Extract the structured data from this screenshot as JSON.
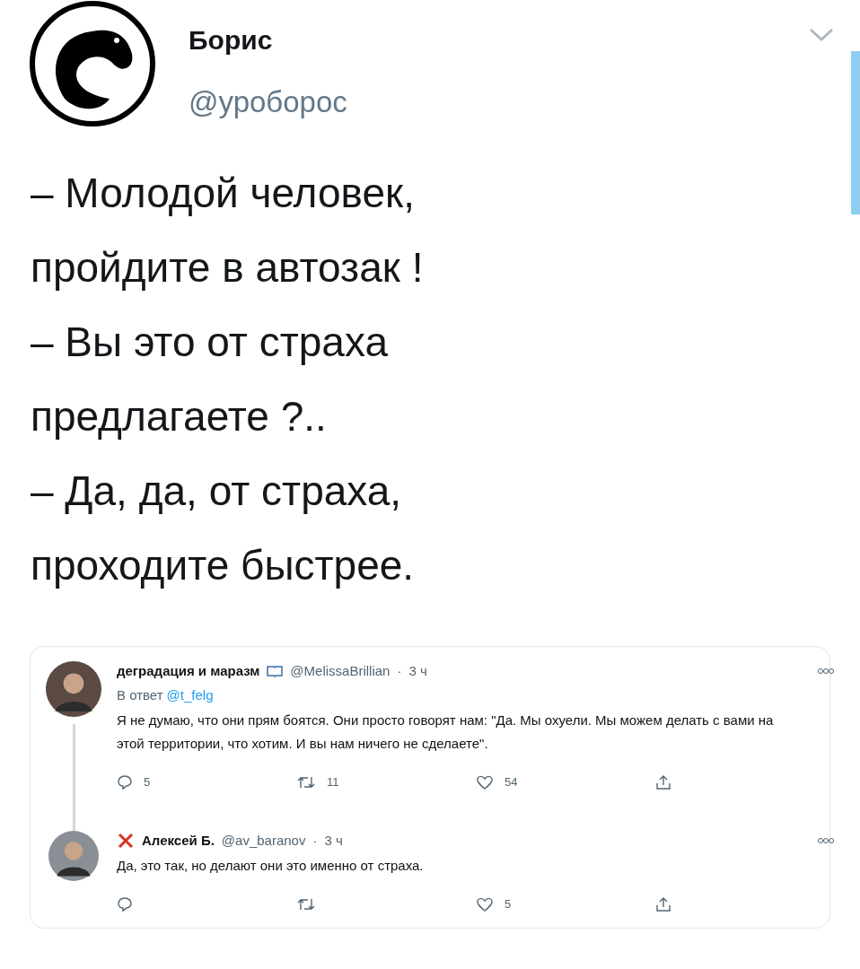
{
  "author": {
    "name": "Борис",
    "handle": "@уроборос"
  },
  "text_lines": [
    "– Молодой человек,",
    "пройдите в автозак !",
    "– Вы это от страха",
    "предлагаете ?..",
    "– Да, да, от страха,",
    "проходите быстрее."
  ],
  "replies": [
    {
      "name": "деградация и маразм",
      "badge": {
        "kind": "book"
      },
      "handle": "@MelissaBrillian",
      "separator": "·",
      "time": "3 ч",
      "reply_prefix": "В ответ",
      "reply_to": "@t_felg",
      "text": "Я не думаю, что они прям боятся. Они просто говорят нам: \"Да. Мы охуели. Мы можем делать с вами на этой территории, что хотим. И вы нам ничего не сделаете\".",
      "thread_line": true,
      "reply_count": "5",
      "retweet_count": "11",
      "like_count": "54"
    },
    {
      "name": "Алексей Б.",
      "badge": {
        "kind": "cross"
      },
      "handle": "@av_baranov",
      "separator": "·",
      "time": "3 ч",
      "text": "Да, это так, но делают они это именно от страха.",
      "thread_line": false,
      "like_count": "5"
    }
  ]
}
